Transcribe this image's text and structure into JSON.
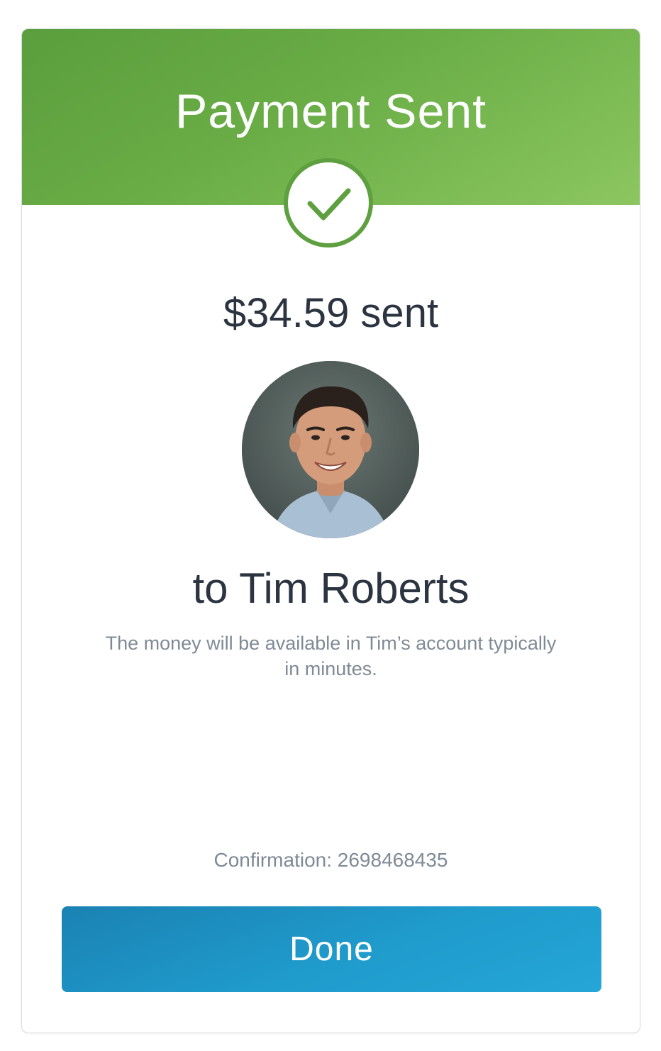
{
  "header": {
    "title": "Payment Sent",
    "color": "#6aad46"
  },
  "icons": {
    "status": "checkmark-icon"
  },
  "payment": {
    "amount_text": "$34.59 sent",
    "recipient_text": "to Tim Roberts",
    "message": "The money will be available in Tim’s account typically in minutes.",
    "confirmation": "Confirmation: 2698468435"
  },
  "actions": {
    "done_label": "Done",
    "done_color": "#1f9bcc"
  }
}
